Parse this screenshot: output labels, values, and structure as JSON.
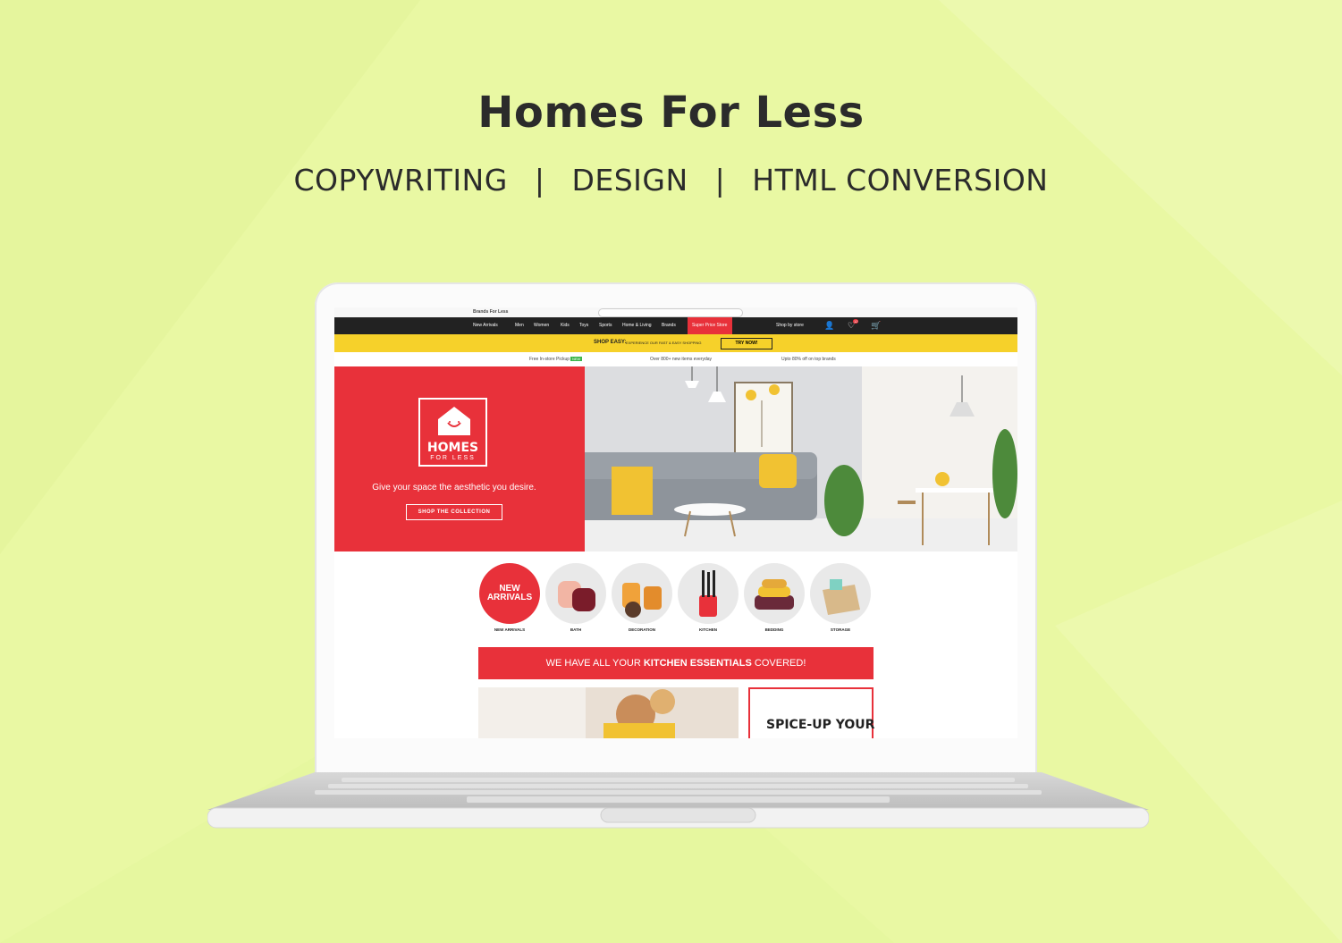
{
  "page": {
    "title": "Homes For Less",
    "services": [
      "COPYWRITING",
      "DESIGN",
      "HTML CONVERSION"
    ],
    "separator": "|"
  },
  "site": {
    "brand_small": "Brands For Less",
    "nav_items": [
      "New Arrivals",
      "Men",
      "Women",
      "Kids",
      "Toys",
      "Sports",
      "Home & Living",
      "Brands"
    ],
    "super_store": "Super Price Store",
    "shop_by_store": "Shop by store",
    "wishlist_count": "12",
    "shopeasy_title": "SHOP EASY:",
    "shopeasy_text": "EXPERIENCE OUR FAST & EASY SHOPPING",
    "try_now": "TRY NOW!",
    "usps": [
      "Free In-store Pickup",
      "Over 800+ new items everyday",
      "Upto 80% off on top brands"
    ],
    "usp_badge": "NEW",
    "hero": {
      "logo_line1": "HOMES",
      "logo_line2": "FOR LESS",
      "tagline": "Give your space the aesthetic you desire.",
      "button": "SHOP THE COLLECTION"
    },
    "categories": [
      {
        "label": "NEW ARRIVALS",
        "circle_text": "NEW ARRIVALS"
      },
      {
        "label": "BATH"
      },
      {
        "label": "DECORATION"
      },
      {
        "label": "KITCHEN"
      },
      {
        "label": "BEDDING"
      },
      {
        "label": "STORAGE"
      }
    ],
    "banner_pre": "WE HAVE ALL YOUR",
    "banner_bold": "KITCHEN ESSENTIALS",
    "banner_post": "COVERED!",
    "spice_text": "SPICE-UP YOUR"
  },
  "colors": {
    "background": "#e9f8a3",
    "brand_red": "#e8313a",
    "brand_yellow": "#f6d12a",
    "nav_dark": "#222222"
  }
}
